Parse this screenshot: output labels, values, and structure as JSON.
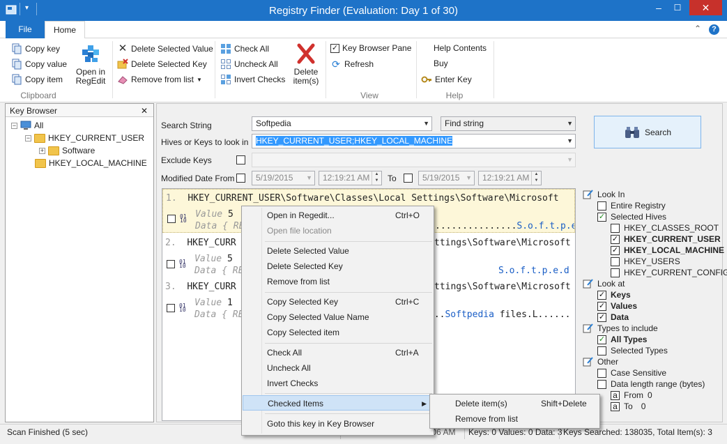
{
  "window": {
    "title": "Registry Finder (Evaluation: Day 1 of 30)",
    "minimize": "–",
    "maximize": "☐",
    "close": "✕",
    "accent": "#1e73c8"
  },
  "ribbon": {
    "tabs": {
      "file": "File",
      "home": "Home"
    },
    "help_icon": "?",
    "collapse_icon": "⌃",
    "clipboard": {
      "copy_key": "Copy key",
      "copy_value": "Copy value",
      "copy_item": "Copy item",
      "label": "Clipboard"
    },
    "open_in_regedit": [
      "Open in",
      "RegEdit"
    ],
    "edit": {
      "delete_value": "Delete Selected Value",
      "delete_key": "Delete Selected Key",
      "remove_from_list": "Remove from list"
    },
    "checks": {
      "check_all": "Check All",
      "uncheck_all": "Uncheck All",
      "invert_checks": "Invert Checks"
    },
    "delete_items": [
      "Delete",
      "item(s)"
    ],
    "view": {
      "key_browser_pane": "Key Browser Pane",
      "refresh": "Refresh",
      "label": "View"
    },
    "help": {
      "help_contents": "Help Contents",
      "buy": "Buy",
      "enter_key": "Enter Key",
      "label": "Help"
    }
  },
  "key_browser": {
    "title": "Key Browser",
    "close": "✕",
    "tree": {
      "all": "All",
      "hkcu": "HKEY_CURRENT_USER",
      "software": "Software",
      "hklm": "HKEY_LOCAL_MACHINE"
    }
  },
  "search": {
    "search_string_label": "Search String",
    "search_string": "Softpedia",
    "find_mode": "Find string",
    "hives_label": "Hives or Keys to look in",
    "hives_value": "HKEY_CURRENT_USER;HKEY_LOCAL_MACHINE",
    "exclude_label": "Exclude Keys",
    "modified_label": "Modified Date From",
    "from_date": "5/19/2015",
    "from_time": "12:19:21 AM",
    "to_label": "To",
    "to_date": "5/19/2015",
    "to_time": "12:19:21 AM",
    "search_button": "Search"
  },
  "results": [
    {
      "num": "1.",
      "path": "HKEY_CURRENT_USER\\Software\\Classes\\Local Settings\\Software\\Microsoft",
      "value_label": "Value",
      "value": "5",
      "data_label": "Data",
      "data_start": "{ RE",
      "data_tail": "...............",
      "data_match": "S.o.f.t.p.e.d"
    },
    {
      "num": "2.",
      "path": "HKEY_CURR",
      "path_tail": "ttings\\Software\\Microsoft",
      "value_label": "Value",
      "value": "5",
      "data_label": "Data",
      "data_start": "{ RE",
      "data_match": "S.o.f.t.p.e.d"
    },
    {
      "num": "3.",
      "path": "HKEY_CURR",
      "path_tail": "ttings\\Software\\Microsoft",
      "value_label": "Value",
      "value": "1",
      "data_label": "Data",
      "data_start": "{ RE",
      "data_dots": "...",
      "data_match": "Softpedia",
      "data_after": " files.L......"
    }
  ],
  "options": {
    "look_in": "Look In",
    "entire_registry": "Entire Registry",
    "selected_hives": "Selected Hives",
    "hives": [
      "HKEY_CLASSES_ROOT",
      "HKEY_CURRENT_USER",
      "HKEY_LOCAL_MACHINE",
      "HKEY_USERS",
      "HKEY_CURRENT_CONFIG"
    ],
    "look_at": "Look at",
    "keys": "Keys",
    "values": "Values",
    "data": "Data",
    "types_to_include": "Types to include",
    "all_types": "All Types",
    "selected_types": "Selected Types",
    "other": "Other",
    "case_sensitive": "Case Sensitive",
    "data_length_range": "Data length range (bytes)",
    "from_label": "From",
    "from_value": "0",
    "to_label": "To",
    "to_value": "0",
    "a_glyph": "a",
    "check_glyph": "✓"
  },
  "status": {
    "left": "Scan Finished (5 sec)",
    "modified": "Modified: 5/18/2015 12:06 AM",
    "keys": "Keys: 0 Values: 0 Data: 3",
    "searched": "Keys Searched: 138035, Total Item(s): 3"
  },
  "context_menu": {
    "open_regedit": "Open in Regedit...",
    "open_regedit_sc": "Ctrl+O",
    "open_file_location": "Open file location",
    "delete_value": "Delete Selected Value",
    "delete_key": "Delete Selected Key",
    "remove_from_list": "Remove from list",
    "copy_key": "Copy Selected Key",
    "copy_key_sc": "Ctrl+C",
    "copy_value_name": "Copy Selected Value Name",
    "copy_item": "Copy Selected item",
    "check_all": "Check All",
    "check_all_sc": "Ctrl+A",
    "uncheck_all": "Uncheck All",
    "invert_checks": "Invert Checks",
    "checked_items": "Checked Items",
    "goto_key": "Goto this key in Key Browser"
  },
  "submenu": {
    "delete_items": "Delete item(s)",
    "delete_items_sc": "Shift+Delete",
    "remove_from_list": "Remove from list"
  }
}
